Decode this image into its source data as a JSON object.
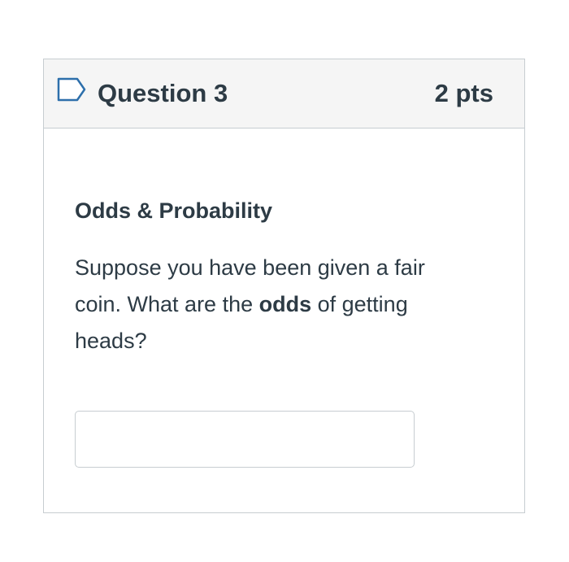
{
  "question": {
    "title": "Question 3",
    "points": "2 pts",
    "flag_icon": "bookmark-flag-icon",
    "heading": "Odds & Probability",
    "text_before": "Suppose you have been given a fair coin. What are the ",
    "text_bold": "odds",
    "text_after": " of getting heads?",
    "answer_value": "",
    "answer_placeholder": ""
  },
  "colors": {
    "text": "#2d3b45",
    "header_bg": "#f5f5f5",
    "border": "#c7cdd1",
    "flag_stroke": "#2d6fab"
  }
}
